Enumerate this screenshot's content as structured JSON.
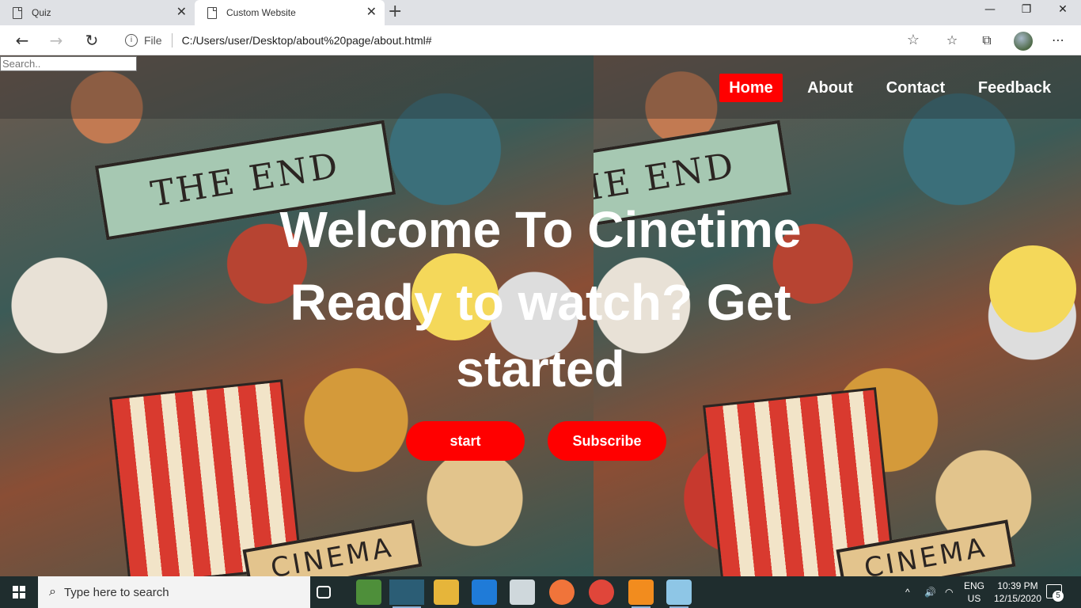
{
  "browser": {
    "tabs": [
      {
        "title": "Quiz",
        "active": false
      },
      {
        "title": "Custom Website",
        "active": true
      }
    ],
    "address": {
      "scheme_label": "File",
      "url": "C:/Users/user/Desktop/about%20page/about.html#"
    }
  },
  "page": {
    "search_placeholder": "Search..",
    "nav": [
      {
        "label": "Home",
        "active": true
      },
      {
        "label": "About",
        "active": false
      },
      {
        "label": "Contact",
        "active": false
      },
      {
        "label": "Feedback",
        "active": false
      }
    ],
    "headline_1": "Welcome To Cinetime",
    "headline_2": "Ready to watch? Get started",
    "buttons": {
      "start": "start",
      "subscribe": "Subscribe"
    },
    "background_text": {
      "banner": "THE END",
      "ribbon": "CINEMA"
    },
    "accent_color": "#ff0000"
  },
  "taskbar": {
    "search_placeholder": "Type here to search",
    "language": {
      "top": "ENG",
      "bottom": "US"
    },
    "time": "10:39 PM",
    "date": "12/15/2020",
    "notification_count": "5"
  }
}
